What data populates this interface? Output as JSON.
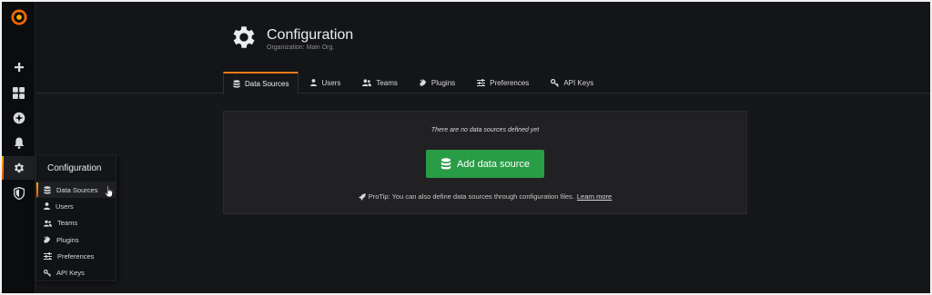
{
  "app": {
    "accent": "#eb7b18",
    "success": "#299c46"
  },
  "sidebar": {
    "items": [
      {
        "icon": "grafana-logo-icon"
      },
      {
        "icon": "plus-icon"
      },
      {
        "icon": "dashboards-icon"
      },
      {
        "icon": "compass-icon"
      },
      {
        "icon": "bell-icon"
      },
      {
        "icon": "gear-icon",
        "active": true
      },
      {
        "icon": "shield-icon"
      }
    ]
  },
  "header": {
    "title": "Configuration",
    "subtitle": "Organization: Main Org.",
    "tabs": [
      {
        "label": "Data Sources",
        "icon": "database-icon",
        "active": true
      },
      {
        "label": "Users",
        "icon": "user-icon"
      },
      {
        "label": "Teams",
        "icon": "users-icon"
      },
      {
        "label": "Plugins",
        "icon": "plug-icon"
      },
      {
        "label": "Preferences",
        "icon": "sliders-icon"
      },
      {
        "label": "API Keys",
        "icon": "key-icon"
      }
    ]
  },
  "empty_state": {
    "message": "There are no data sources defined yet",
    "button_label": "Add data source",
    "protip_text": "ProTip: You can also define data sources through configuration files.",
    "protip_link": "Learn more"
  },
  "flyout": {
    "title": "Configuration",
    "items": [
      {
        "label": "Data Sources",
        "icon": "database-icon",
        "active": true
      },
      {
        "label": "Users",
        "icon": "user-icon"
      },
      {
        "label": "Teams",
        "icon": "users-icon"
      },
      {
        "label": "Plugins",
        "icon": "plug-icon"
      },
      {
        "label": "Preferences",
        "icon": "sliders-icon"
      },
      {
        "label": "API Keys",
        "icon": "key-icon"
      }
    ]
  }
}
